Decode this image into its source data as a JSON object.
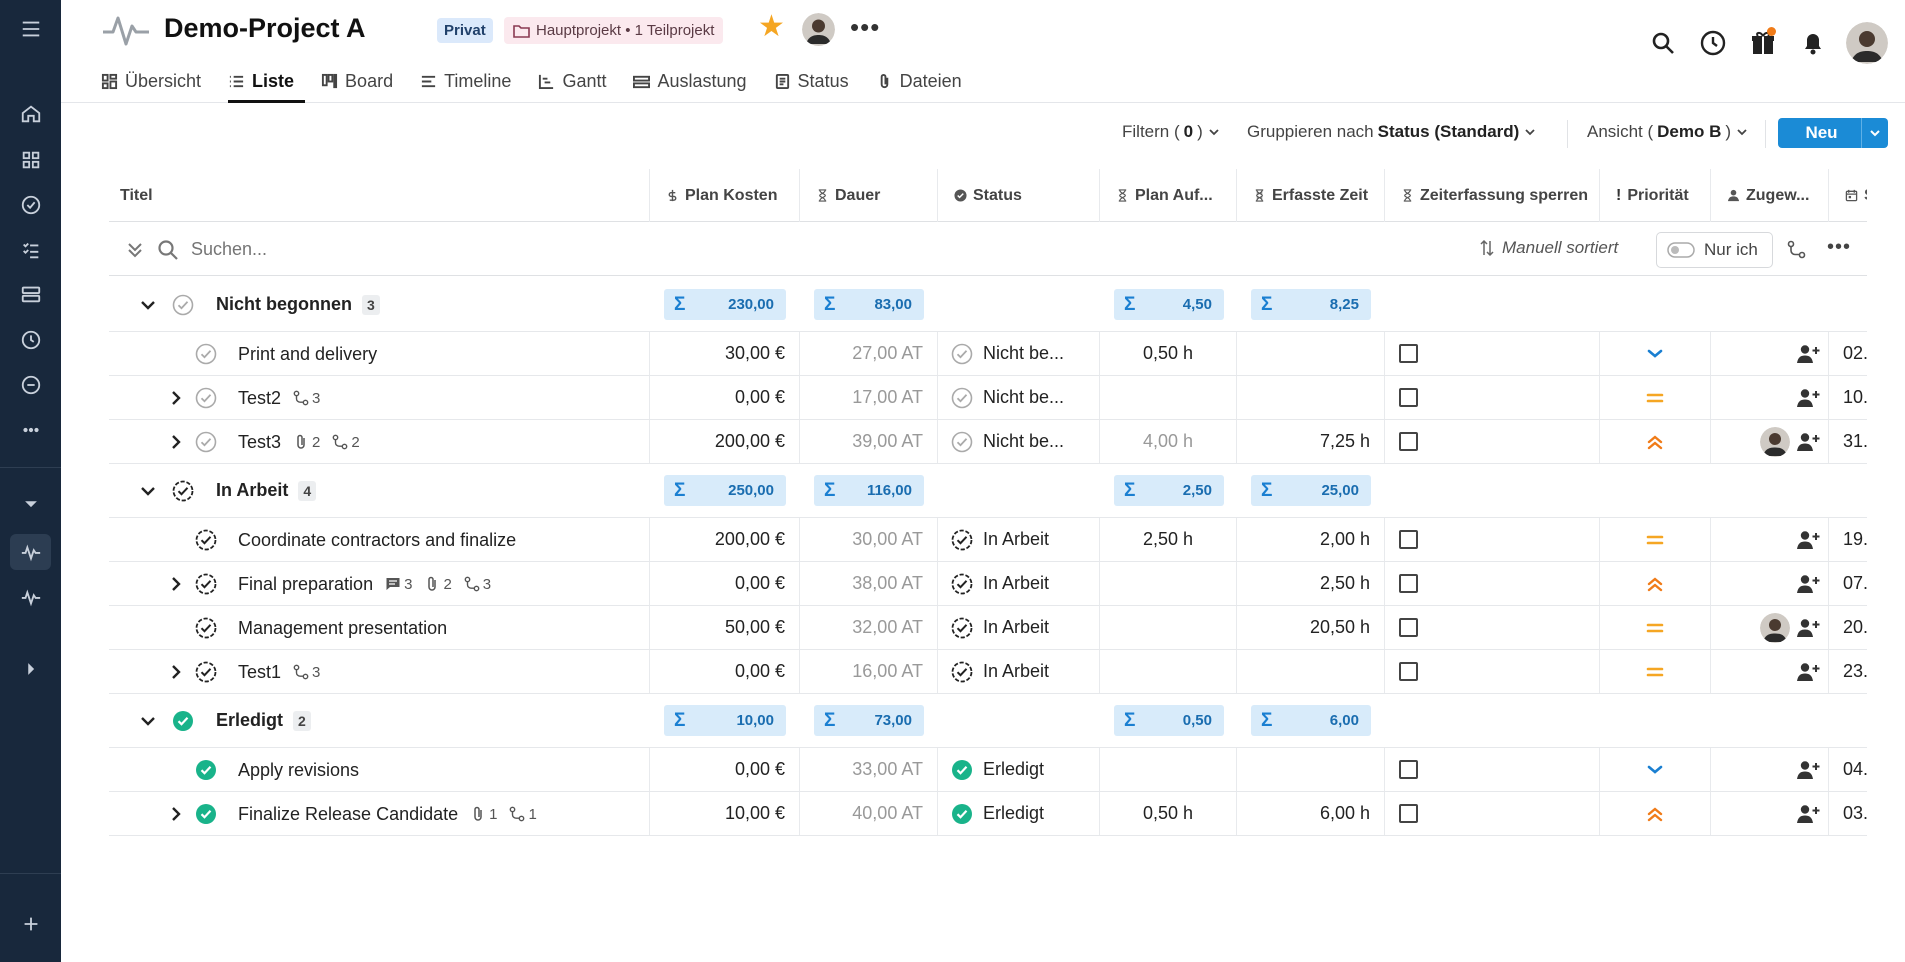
{
  "project": {
    "title": "Demo-Project A",
    "visibility": "Privat",
    "hierarchy": "Hauptprojekt • 1 Teilprojekt"
  },
  "tabs": [
    {
      "label": "Übersicht",
      "icon": "overview-icon"
    },
    {
      "label": "Liste",
      "icon": "list-icon",
      "active": true
    },
    {
      "label": "Board",
      "icon": "board-icon"
    },
    {
      "label": "Timeline",
      "icon": "timeline-icon"
    },
    {
      "label": "Gantt",
      "icon": "gantt-icon"
    },
    {
      "label": "Auslastung",
      "icon": "workload-icon"
    },
    {
      "label": "Status",
      "icon": "status-icon"
    },
    {
      "label": "Dateien",
      "icon": "paperclip-icon"
    }
  ],
  "toolbar": {
    "filter_prefix": "Filtern (",
    "filter_count": "0",
    "filter_suffix": ")",
    "group_prefix": "Gruppieren nach ",
    "group_value": "Status (Standard)",
    "view_prefix": "Ansicht (",
    "view_value": "Demo B",
    "view_suffix": ")",
    "new_label": "Neu"
  },
  "columns": {
    "title": "Titel",
    "plan_kosten": "Plan Kosten",
    "dauer": "Dauer",
    "status": "Status",
    "plan_auf": "Plan Auf...",
    "erfasste_zeit": "Erfasste Zeit",
    "zeit_sperren": "Zeiterfassung sperren",
    "prioritaet": "Priorität",
    "zugewiesen": "Zugew..."
  },
  "search": {
    "placeholder": "Suchen...",
    "sort_label": "Manuell sortiert",
    "only_me": "Nur ich"
  },
  "groups": [
    {
      "name": "Nicht begonnen",
      "count": "3",
      "state": "todo",
      "sums": {
        "kosten": "230,00",
        "dauer": "83,00",
        "plan": "4,50",
        "erfasst": "8,25"
      },
      "rows": [
        {
          "title": "Print and delivery",
          "expand": false,
          "kosten": "30,00 €",
          "dauer": "27,00 AT",
          "status": "Nicht be...",
          "plan": "0,50 h",
          "plan_muted": false,
          "erfasst": "",
          "prio": "low",
          "avatar": false,
          "date": "02.",
          "meta": []
        },
        {
          "title": "Test2",
          "expand": true,
          "kosten": "0,00 €",
          "dauer": "17,00 AT",
          "status": "Nicht be...",
          "plan": "",
          "plan_muted": false,
          "erfasst": "",
          "prio": "medium",
          "avatar": false,
          "date": "10.",
          "meta": [
            {
              "icon": "subtask-icon",
              "value": "3"
            }
          ]
        },
        {
          "title": "Test3",
          "expand": true,
          "kosten": "200,00 €",
          "dauer": "39,00 AT",
          "status": "Nicht be...",
          "plan": "4,00 h",
          "plan_muted": true,
          "erfasst": "7,25 h",
          "prio": "high",
          "avatar": true,
          "date": "31.",
          "meta": [
            {
              "icon": "paperclip-icon",
              "value": "2"
            },
            {
              "icon": "subtask-icon",
              "value": "2"
            }
          ]
        }
      ]
    },
    {
      "name": "In Arbeit",
      "count": "4",
      "state": "progress",
      "sums": {
        "kosten": "250,00",
        "dauer": "116,00",
        "plan": "2,50",
        "erfasst": "25,00"
      },
      "rows": [
        {
          "title": "Coordinate contractors and finalize",
          "expand": false,
          "kosten": "200,00 €",
          "dauer": "30,00 AT",
          "status": "In Arbeit",
          "plan": "2,50 h",
          "plan_muted": false,
          "erfasst": "2,00 h",
          "prio": "medium",
          "avatar": false,
          "date": "19.",
          "meta": []
        },
        {
          "title": "Final preparation",
          "expand": true,
          "kosten": "0,00 €",
          "dauer": "38,00 AT",
          "status": "In Arbeit",
          "plan": "",
          "plan_muted": false,
          "erfasst": "2,50 h",
          "prio": "high",
          "avatar": false,
          "date": "07.",
          "meta": [
            {
              "icon": "comment-icon",
              "value": "3"
            },
            {
              "icon": "paperclip-icon",
              "value": "2"
            },
            {
              "icon": "subtask-icon",
              "value": "3"
            }
          ]
        },
        {
          "title": "Management presentation",
          "expand": false,
          "kosten": "50,00 €",
          "dauer": "32,00 AT",
          "status": "In Arbeit",
          "plan": "",
          "plan_muted": false,
          "erfasst": "20,50 h",
          "prio": "medium",
          "avatar": true,
          "date": "20.",
          "meta": []
        },
        {
          "title": "Test1",
          "expand": true,
          "kosten": "0,00 €",
          "dauer": "16,00 AT",
          "status": "In Arbeit",
          "plan": "",
          "plan_muted": false,
          "erfasst": "",
          "prio": "medium",
          "avatar": false,
          "date": "23.",
          "meta": [
            {
              "icon": "subtask-icon",
              "value": "3"
            }
          ]
        }
      ]
    },
    {
      "name": "Erledigt",
      "count": "2",
      "state": "done",
      "sums": {
        "kosten": "10,00",
        "dauer": "73,00",
        "plan": "0,50",
        "erfasst": "6,00"
      },
      "rows": [
        {
          "title": "Apply revisions",
          "expand": false,
          "kosten": "0,00 €",
          "dauer": "33,00 AT",
          "status": "Erledigt",
          "plan": "",
          "plan_muted": false,
          "erfasst": "",
          "prio": "low",
          "avatar": false,
          "date": "04.",
          "meta": []
        },
        {
          "title": "Finalize Release Candidate",
          "expand": true,
          "kosten": "10,00 €",
          "dauer": "40,00 AT",
          "status": "Erledigt",
          "plan": "0,50 h",
          "plan_muted": false,
          "erfasst": "6,00 h",
          "prio": "high",
          "avatar": false,
          "date": "03.",
          "meta": [
            {
              "icon": "paperclip-icon",
              "value": "1"
            },
            {
              "icon": "subtask-icon",
              "value": "1"
            }
          ]
        }
      ]
    }
  ],
  "colors": {
    "sidebar": "#18283c",
    "accent": "#1b8bd6",
    "done": "#19b38a",
    "prio_low": "#1a7fd1",
    "prio_medium": "#f5a623",
    "prio_high": "#f07b18",
    "star": "#f5a623"
  }
}
